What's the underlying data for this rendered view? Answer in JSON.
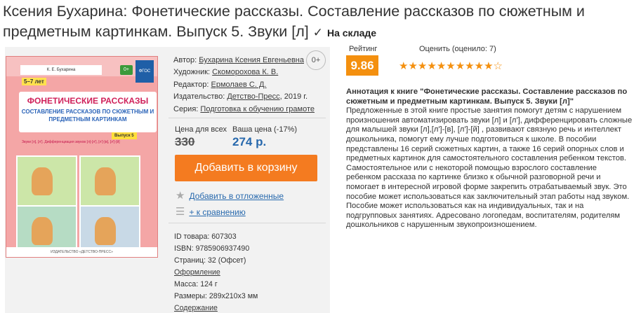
{
  "title": "Ксения Бухарина: Фонетические рассказы. Составление рассказов по сюжетным и предметным картинкам. Выпуск 5. Звуки [л]",
  "stock": {
    "check": "✓",
    "label": "На складе"
  },
  "age": "0+",
  "cover": {
    "author": "К. Е. Бухарина",
    "age_tag": "5–7 лет",
    "zero": "0+",
    "fgos": "ФГОС",
    "title_line": "ФОНЕТИЧЕСКИЕ РАССКАЗЫ",
    "subtitle_line": "СОСТАВЛЕНИЕ РАССКАЗОВ ПО СЮЖЕТНЫМ И ПРЕДМЕТНЫМ КАРТИНКАМ",
    "issue": "Выпуск 5",
    "sounds": "Звуки [л], [л']. Дифференциация звуков [л]-[л'], [л']-[в], [л']-[й]",
    "publisher": "ИЗДАТЕЛЬСТВО «ДЕТСТВО-ПРЕСС»"
  },
  "details": {
    "author_label": "Автор:",
    "author": "Бухарина Ксения Евгеньевна",
    "illustrator_label": "Художник:",
    "illustrator": "Скоморохова К. В.",
    "editor_label": "Редактор:",
    "editor": "Ермолаев С. Д.",
    "publisher_label": "Издательство:",
    "publisher": "Детство-Пресс",
    "year": ", 2019 г.",
    "series_label": "Серия:",
    "series": "Подготовка к обучению грамоте"
  },
  "price": {
    "all_label": "Цена для всех",
    "your_label": "Ваша цена (-17%)",
    "old": "330",
    "new": "274 р."
  },
  "cart_button": "Добавить в корзину",
  "actions": {
    "wishlist": "Добавить в отложенные",
    "compare": "+ к сравнению",
    "wishlist_icon": "star-icon",
    "compare_icon": "list-icon"
  },
  "info": {
    "id": "ID товара: 607303",
    "isbn": "ISBN: 9785906937490",
    "pages": "Страниц: 32 (Офсет)",
    "design": "Оформление",
    "mass": "Масса: 124 г",
    "size": "Размеры: 289x210x3 мм",
    "contents": "Содержание"
  },
  "rating": {
    "label": "Рейтинг",
    "value": "9.86",
    "rate_label": "Оценить (оценило: 7)",
    "stars_filled": 10,
    "stars_total": 11,
    "color": "#f4900f"
  },
  "annotation": {
    "heading": "Аннотация к книге \"Фонетические рассказы. Составление рассказов по сюжетным и предметным картинкам. Выпуск 5. Звуки [л]\"",
    "body": "Предложенные в этой книге простые занятия помогут детям с нарушением произношения автоматизировать звуки [л] и [л'], дифференцировать сложные для малышей звуки [л],[л']-[в], [л']-[й] , развивают связную речь и интеллект дошкольника, помогут ему лучше подготовиться к школе. В пособии представлены 16 серий сюжетных картин, а также 16 серий опорных слов и предметных картинок для самостоятельного составления ребенком текстов. Самостоятельное или с некоторой помощью взрослого составление ребенком рассказа по картинке близко к обычной разговорной речи и помогает в интересной игровой форме закрепить отрабатываемый звук. Это пособие может использоваться как заключительный этап работы над звуком. Пособие может использоваться как на индивидуальных, так и на подгрупповых занятиях. Адресовано логопедам, воспитателям, родителям дошкольников с нарушенным звукопроизношением."
  },
  "colors": {
    "accent": "#f47b20",
    "link": "#2869ad",
    "panel": "#f2f2f2"
  }
}
